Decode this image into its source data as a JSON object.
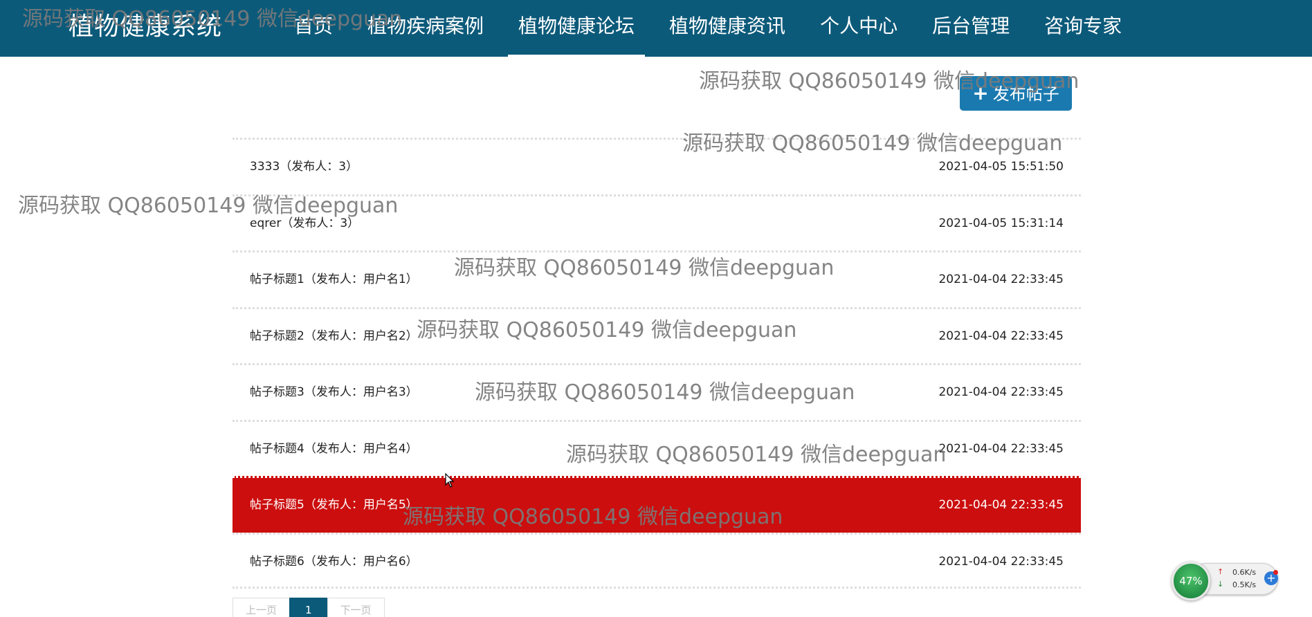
{
  "brand": {
    "title": "植物健康系统"
  },
  "nav": [
    {
      "label": "首页"
    },
    {
      "label": "植物疾病案例"
    },
    {
      "label": "植物健康论坛"
    },
    {
      "label": "植物健康资讯"
    },
    {
      "label": "个人中心"
    },
    {
      "label": "后台管理"
    },
    {
      "label": "咨询专家"
    }
  ],
  "toolbar": {
    "post_label": "发布帖子",
    "post_icon": "plus-icon"
  },
  "posts": [
    {
      "title": "3333（发布人：3）",
      "time": "2021-04-05 15:51:50"
    },
    {
      "title": "eqrer（发布人：3）",
      "time": "2021-04-05 15:31:14"
    },
    {
      "title": "帖子标题1（发布人：用户名1）",
      "time": "2021-04-04 22:33:45"
    },
    {
      "title": "帖子标题2（发布人：用户名2）",
      "time": "2021-04-04 22:33:45"
    },
    {
      "title": "帖子标题3（发布人：用户名3）",
      "time": "2021-04-04 22:33:45"
    },
    {
      "title": "帖子标题4（发布人：用户名4）",
      "time": "2021-04-04 22:33:45"
    },
    {
      "title": "帖子标题5（发布人：用户名5）",
      "time": "2021-04-04 22:33:45"
    },
    {
      "title": "帖子标题6（发布人：用户名6）",
      "time": "2021-04-04 22:33:45"
    }
  ],
  "pagination": {
    "prev": "上一页",
    "current": "1",
    "next": "下一页"
  },
  "watermark": {
    "text": "源码获取 QQ86050149 微信deepguan"
  },
  "net_widget": {
    "percent": "47%",
    "up": "0.6K/s",
    "down": "0.5K/s"
  },
  "colors": {
    "header": "#0c5a7a",
    "button": "#1a7ab0",
    "highlight": "#cc0e0e"
  }
}
